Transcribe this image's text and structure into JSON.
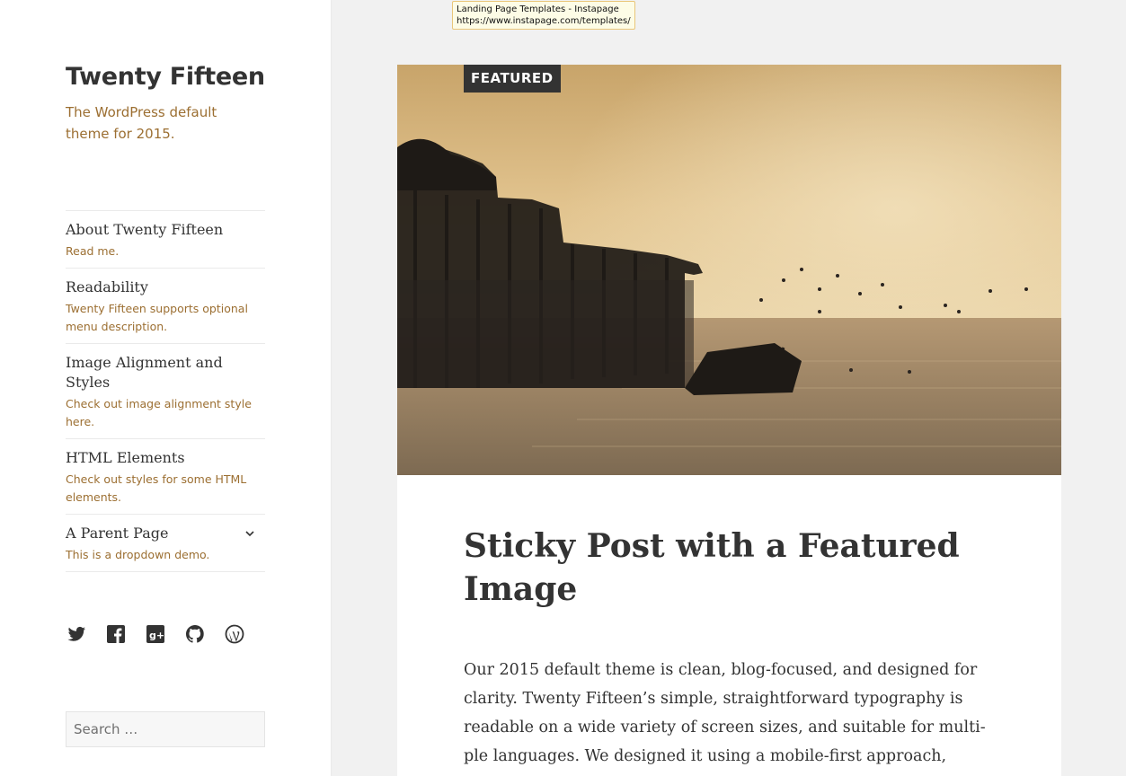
{
  "site": {
    "title": "Twenty Fifteen",
    "description": "The WordPress default theme for 2015."
  },
  "menu": [
    {
      "label": "About Twenty Fifteen",
      "description": "Read me."
    },
    {
      "label": "Readability",
      "description": "Twenty Fifteen supports optional menu description."
    },
    {
      "label": "Image Alignment and Styles",
      "description": "Check out image alignment style here."
    },
    {
      "label": "HTML Elements",
      "description": "Check out styles for some HTML elements."
    },
    {
      "label": "A Parent Page",
      "description": "This is a dropdown demo.",
      "has_dropdown": true
    }
  ],
  "social_icons": [
    "twitter-icon",
    "facebook-icon",
    "google-plus-icon",
    "github-icon",
    "wordpress-icon"
  ],
  "search": {
    "placeholder": "Search …"
  },
  "tooltip": {
    "line1": "Landing Page Templates - Instapage",
    "line2": "https://www.instapage.com/templates/"
  },
  "post": {
    "badge": "FEATURED",
    "title": "Sticky Post with a Featured Image",
    "content": "Our 2015 default theme is clean, blog-focused, and designed for clarity. Twenty Fifteen’s simple, straightforward typography is readable on a wide variety of screen sizes, and suitable for multi-ple languages. We designed it using a mobile-first approach,"
  },
  "colors": {
    "accent": "#9c6f32",
    "text": "#333333",
    "background": "#f1f1f1",
    "sidebar": "#ffffff"
  }
}
